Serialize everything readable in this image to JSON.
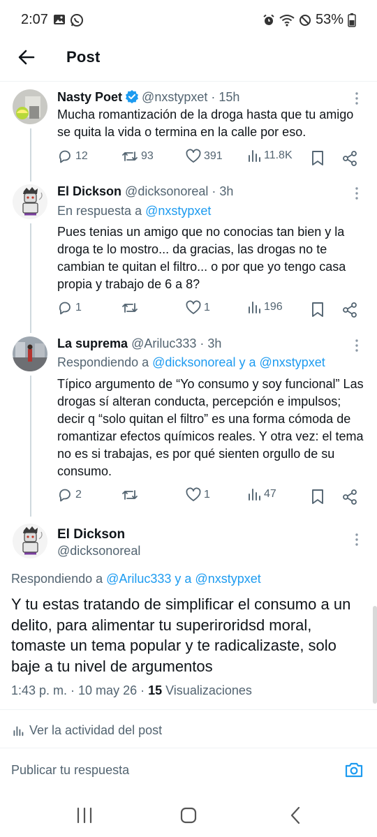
{
  "status_bar": {
    "time": "2:07",
    "battery": "53%"
  },
  "header": {
    "title": "Post"
  },
  "tweets": [
    {
      "name": "Nasty Poet",
      "handle": "@nxstypxet",
      "time": "15h",
      "verified": true,
      "text": "Mucha romantización de la droga hasta que tu amigo se quita la vida o termina en la calle por eso.",
      "replies": "12",
      "reposts": "93",
      "likes": "391",
      "views": "11.8K"
    },
    {
      "name": "El Dickson",
      "handle": "@dicksonoreal",
      "time": "3h",
      "reply_prefix": "En respuesta a ",
      "reply_mentions": "@nxstypxet",
      "text": "Pues tenias un amigo que no conocias tan bien y la droga te lo mostro... da gracias, las drogas no te cambian te quitan el filtro... o por que yo tengo casa propia y trabajo de 6 a 8?",
      "replies": "1",
      "reposts": "",
      "likes": "1",
      "views": "196"
    },
    {
      "name": "La suprema",
      "handle": "@Ariluc333",
      "time": "3h",
      "reply_prefix": "Respondiendo a ",
      "reply_mentions": "@dicksonoreal y a @nxstypxet",
      "text": "Típico argumento de “Yo consumo y soy funcional” Las drogas sí alteran conducta, percepción e impulsos; decir q “solo quitan el filtro” es una forma cómoda de romantizar efectos químicos reales. Y otra vez: el tema no es si trabajas, es por qué sienten orgullo de su consumo.",
      "replies": "2",
      "reposts": "",
      "likes": "1",
      "views": "47"
    }
  ],
  "main_post": {
    "name": "El Dickson",
    "handle": "@dicksonoreal",
    "reply_prefix": "Respondiendo a ",
    "reply_mentions": "@Ariluc333 y a @nxstypxet",
    "text": "Y tu estas tratando de simplificar el consumo a un delito, para alimentar tu superiroridsd moral, tomaste un tema popular y te radicalizaste, solo baje a tu nivel de argumentos",
    "timestamp": "1:43 p. m. · 10 may 26 · ",
    "views_count": "15",
    "views_label": " Visualizaciones",
    "activity_label": "Ver la actividad del post"
  },
  "compose": {
    "placeholder": "Publicar tu respuesta"
  },
  "colors": {
    "accent": "#1d9bf0",
    "secondary_text": "#536471",
    "thread_line": "#cfd9de"
  }
}
